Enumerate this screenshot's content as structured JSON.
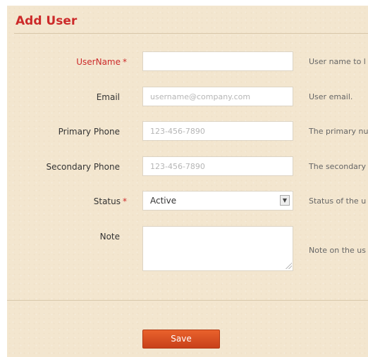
{
  "form": {
    "title": "Add User",
    "fields": {
      "username": {
        "label": "UserName",
        "required_mark": "*",
        "value": "",
        "placeholder": "",
        "help": "User name to l"
      },
      "email": {
        "label": "Email",
        "value": "",
        "placeholder": "username@company.com",
        "help": "User email."
      },
      "primary_phone": {
        "label": "Primary Phone",
        "value": "",
        "placeholder": "123-456-7890",
        "help": "The primary nu"
      },
      "secondary_phone": {
        "label": "Secondary Phone",
        "value": "",
        "placeholder": "123-456-7890",
        "help": "The secondary"
      },
      "status": {
        "label": "Status",
        "required_mark": "*",
        "selected": "Active",
        "help": "Status of the u"
      },
      "note": {
        "label": "Note",
        "value": "",
        "help": "Note on the us"
      }
    },
    "save_label": "Save"
  },
  "colors": {
    "accent": "#cc2a2a",
    "panel_bg": "#f3e6cf",
    "button": "#d9501f"
  }
}
